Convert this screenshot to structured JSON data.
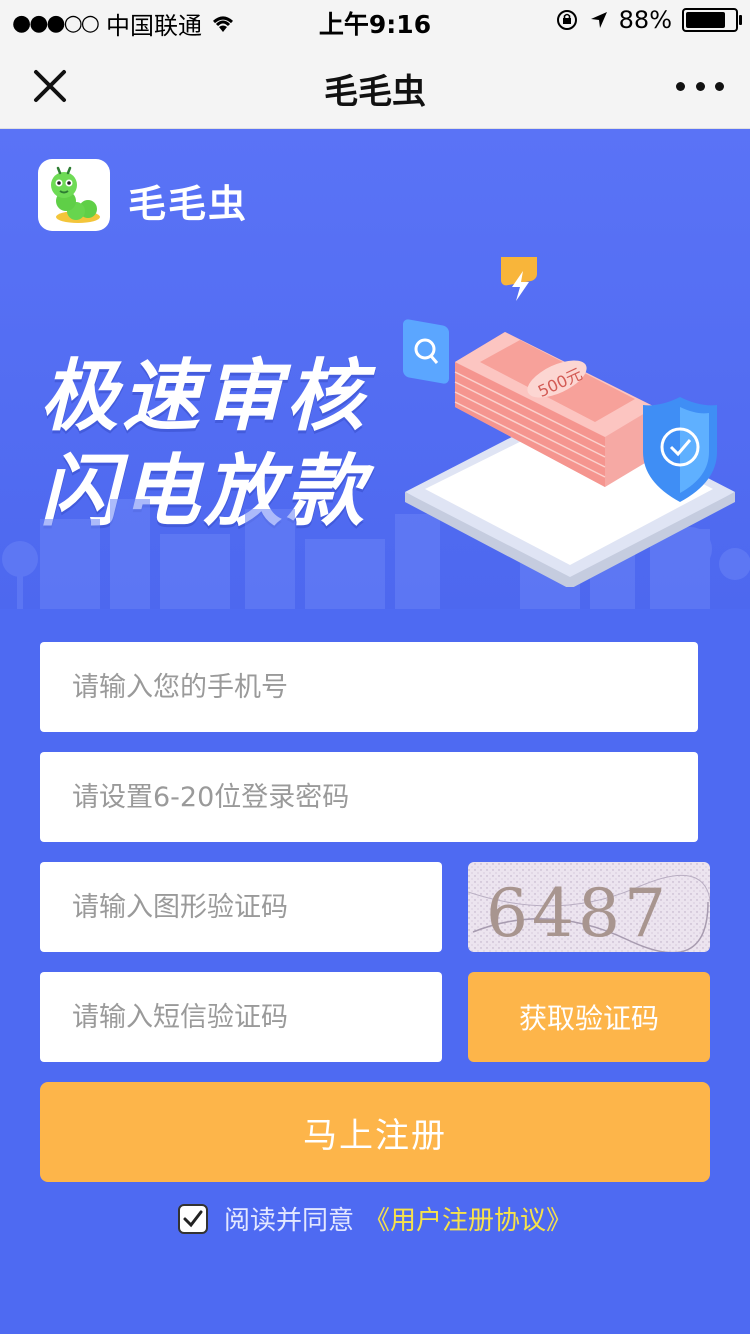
{
  "status_bar": {
    "carrier": "中国联通",
    "time": "上午9:16",
    "battery": "88%",
    "battery_level": 0.88
  },
  "navbar": {
    "title": "毛毛虫"
  },
  "hero": {
    "brand_name": "毛毛虫",
    "slogan_line1": "极速审核",
    "slogan_line2": "闪电放款",
    "banknote_label": "500元"
  },
  "form": {
    "phone_placeholder": "请输入您的手机号",
    "password_placeholder": "请设置6-20位登录密码",
    "captcha_placeholder": "请输入图形验证码",
    "captcha_code": "6487",
    "sms_placeholder": "请输入短信验证码",
    "sms_button": "获取验证码",
    "register_button": "马上注册"
  },
  "agreement": {
    "checked": true,
    "text": "阅读并同意",
    "link": "《用户注册协议》"
  },
  "colors": {
    "primary": "#4e6af2",
    "accent": "#fdb54a",
    "link": "#f7e24a"
  }
}
